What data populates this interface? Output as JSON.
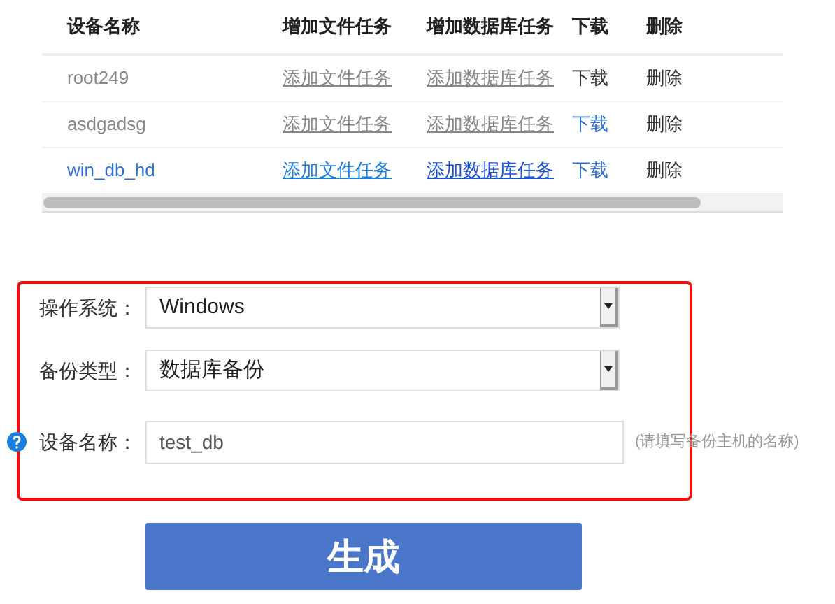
{
  "table": {
    "columns": [
      "设备名称",
      "增加文件任务",
      "增加数据库任务",
      "下载",
      "删除"
    ],
    "rows": [
      {
        "name": "root249",
        "file_task": "添加文件任务",
        "db_task": "添加数据库任务",
        "download": "下载",
        "download_enabled": false,
        "delete": "删除",
        "selected": false
      },
      {
        "name": "asdgadsg",
        "file_task": "添加文件任务",
        "db_task": "添加数据库任务",
        "download": "下载",
        "download_enabled": true,
        "delete": "删除",
        "selected": false
      },
      {
        "name": "win_db_hd",
        "file_task": "添加文件任务",
        "db_task": "添加数据库任务",
        "download": "下载",
        "download_enabled": true,
        "delete": "删除",
        "selected": true
      }
    ]
  },
  "form": {
    "fields": [
      {
        "kind": "select",
        "label": "操作系统：",
        "value": "Windows"
      },
      {
        "kind": "select",
        "label": "备份类型：",
        "value": "数据库备份"
      },
      {
        "kind": "input",
        "label": "设备名称：",
        "value": "test_db",
        "hint": "(请填写备份主机的名称)",
        "help": true
      }
    ]
  },
  "submit": "生成"
}
